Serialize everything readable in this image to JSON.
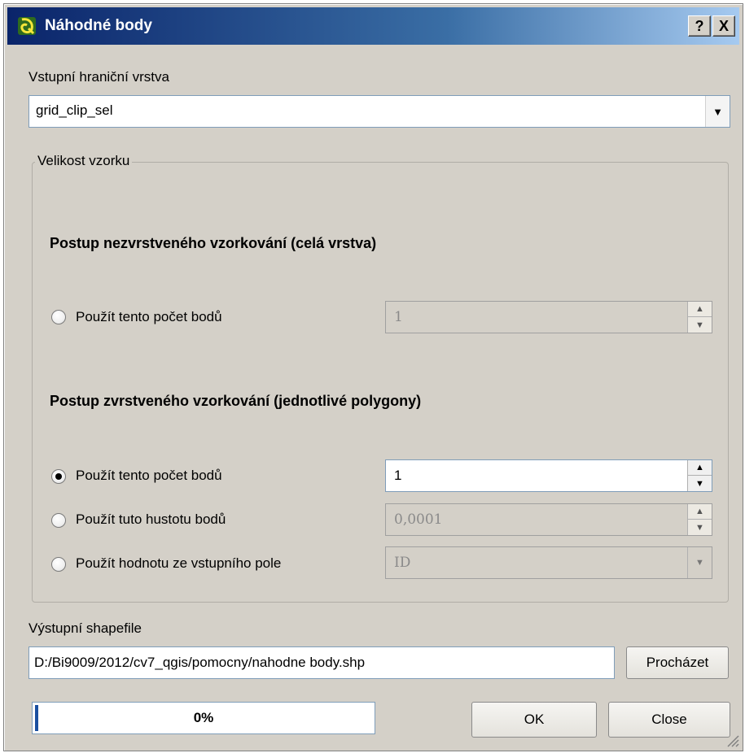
{
  "window": {
    "title": "Náhodné body",
    "help_label": "?",
    "close_label": "X"
  },
  "input_layer": {
    "label": "Vstupní hraniční vrstva",
    "value": "grid_clip_sel"
  },
  "sample_size": {
    "group_title": "Velikost vzorku",
    "unstratified": {
      "heading": "Postup nezvrstveného vzorkování (celá vrstva)",
      "use_count_label": "Použít tento počet bodů",
      "use_count_checked": false,
      "count_value": "1"
    },
    "stratified": {
      "heading": "Postup zvrstveného vzorkování (jednotlivé polygony)",
      "use_count_label": "Použít tento počet bodů",
      "use_count_checked": true,
      "count_value": "1",
      "use_density_label": "Použít tuto hustotu bodů",
      "use_density_checked": false,
      "density_value": "0,0001",
      "use_field_label": "Použít hodnotu ze vstupního pole",
      "use_field_checked": false,
      "field_value": "ID"
    }
  },
  "output": {
    "label": "Výstupní shapefile",
    "path": "D:/Bi9009/2012/cv7_qgis/pomocny/nahodne body.shp",
    "browse_label": "Procházet"
  },
  "progress": {
    "percent": 0,
    "label": "0%"
  },
  "buttons": {
    "ok_label": "OK",
    "close_label": "Close"
  },
  "colors": {
    "title_bar": "#0a246a",
    "dialog_background": "#d4d0c8",
    "progress_fill": "#1a4fa0"
  },
  "icons": {
    "app": "qgis-icon",
    "combo_arrow": "chevron-down-icon",
    "spin_up": "spin-up-icon",
    "spin_down": "spin-down-icon"
  }
}
